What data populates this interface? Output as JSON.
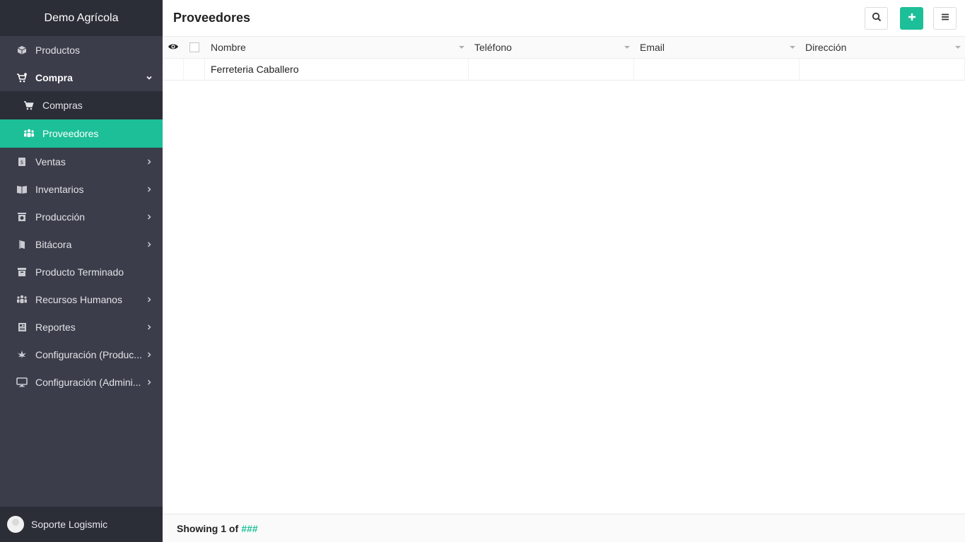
{
  "brand": {
    "title": "Demo Agrícola"
  },
  "sidebar": {
    "items": [
      {
        "label": "Productos",
        "icon": "cube-icon"
      },
      {
        "label": "Compra",
        "icon": "cart-user-icon",
        "open": true
      },
      {
        "label": "Ventas",
        "icon": "dollar-icon"
      },
      {
        "label": "Inventarios",
        "icon": "book-icon"
      },
      {
        "label": "Producción",
        "icon": "box-scale-icon"
      },
      {
        "label": "Bitácora",
        "icon": "notebook-icon"
      },
      {
        "label": "Producto Terminado",
        "icon": "archive-icon"
      },
      {
        "label": "Recursos Humanos",
        "icon": "users-icon"
      },
      {
        "label": "Reportes",
        "icon": "newspaper-icon"
      },
      {
        "label": "Configuración (Produc...",
        "icon": "leaf-icon"
      },
      {
        "label": "Configuración (Admini...",
        "icon": "monitor-icon"
      }
    ],
    "compra_sub": [
      {
        "label": "Compras",
        "icon": "cart-icon"
      },
      {
        "label": "Proveedores",
        "icon": "users-icon",
        "active": true
      }
    ]
  },
  "user": {
    "name": "Soporte Logismic"
  },
  "header": {
    "title": "Proveedores"
  },
  "grid": {
    "columns": [
      "Nombre",
      "Teléfono",
      "Email",
      "Dirección"
    ],
    "rows": [
      [
        "Ferreteria Caballero",
        "",
        "",
        ""
      ]
    ]
  },
  "footer": {
    "showing": "Showing 1 of",
    "total": "###"
  },
  "colors": {
    "accent": "#1dbf98",
    "sidebar": "#3b3d4a",
    "sidebar_dark": "#2b2d37"
  }
}
